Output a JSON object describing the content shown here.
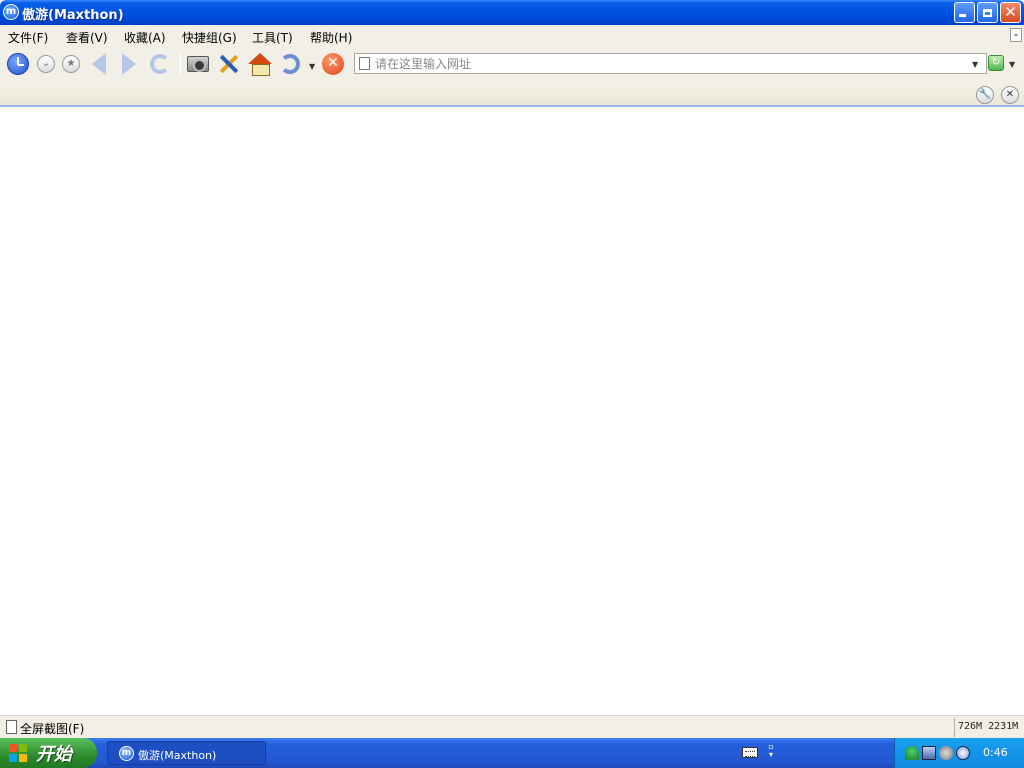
{
  "window": {
    "title": "傲游(Maxthon)",
    "app_icon_glyph": "m"
  },
  "menu": {
    "items": [
      {
        "label": "文件(F)"
      },
      {
        "label": "查看(V)"
      },
      {
        "label": "收藏(A)"
      },
      {
        "label": "快捷组(G)"
      },
      {
        "label": "工具(T)"
      },
      {
        "label": "帮助(H)"
      }
    ]
  },
  "toolbar": {
    "icons": [
      "history-icon",
      "dropdown-circle-icon",
      "star-icon",
      "back-icon",
      "forward-icon",
      "refresh-icon",
      "camera-icon",
      "tools-icon",
      "home-icon",
      "undo-icon",
      "stop-icon"
    ]
  },
  "address": {
    "placeholder": "请在这里输入网址",
    "value": ""
  },
  "status": {
    "text": "全屏截图(F)",
    "memory": "726M 2231M"
  },
  "taskbar": {
    "start_label": "开始",
    "task_label": "傲游(Maxthon)",
    "clock": "0:46"
  },
  "colors": {
    "titlebar": "#0054e3",
    "chrome_bg": "#f2f0e6",
    "taskbar": "#2457d1",
    "start_green": "#2c8a2c",
    "tray": "#0f89e0"
  }
}
